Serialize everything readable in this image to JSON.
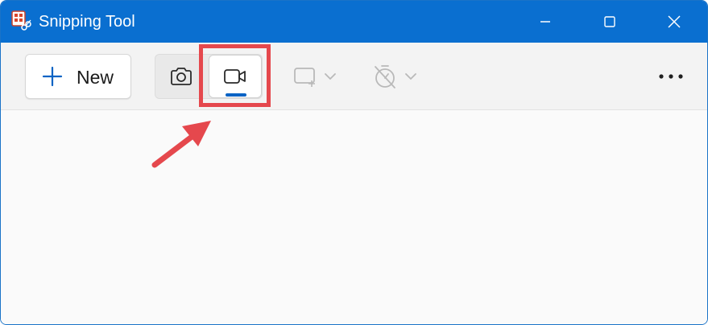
{
  "window": {
    "title": "Snipping Tool",
    "titlebar_color": "#0a6fd0",
    "buttons": {
      "minimize": "minimize-icon",
      "maximize": "maximize-icon",
      "close": "close-icon"
    }
  },
  "toolbar": {
    "new_label": "New",
    "modes": [
      {
        "name": "snip-mode-screenshot",
        "icon": "camera-icon",
        "selected": false
      },
      {
        "name": "snip-mode-video",
        "icon": "video-camera-icon",
        "selected": true
      }
    ],
    "shape_dropdown_icon": "rectangle-snip-icon",
    "timer_dropdown_icon": "no-timer-icon",
    "more_icon": "more-options-icon",
    "accent_color": "#0a63c4"
  },
  "annotation": {
    "highlight_color": "#e5484d",
    "arrow_color": "#e5484d"
  }
}
